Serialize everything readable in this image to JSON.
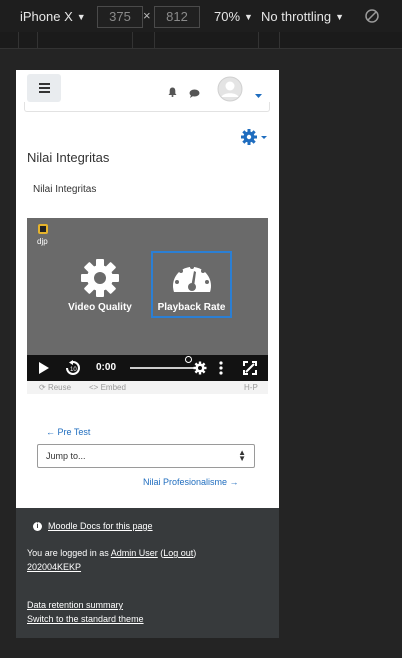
{
  "devtools": {
    "device": "iPhone X",
    "width": "375",
    "height": "812",
    "times": "×",
    "zoom": "70%",
    "throttling": "No throttling"
  },
  "page": {
    "title": "Nilai Integritas",
    "subtitle": "Nilai Integritas"
  },
  "player": {
    "logo_text": "djp",
    "video_quality": "Video Quality",
    "playback_rate": "Playback Rate",
    "time": "0:00",
    "reuse": "Reuse",
    "embed": "Embed",
    "h5p": "H-P"
  },
  "activity_nav": {
    "prev": "← Pre Test",
    "jump": "Jump to...",
    "next": "Nilai Profesionalisme →"
  },
  "footer": {
    "docs": "Moodle Docs for this page",
    "logged_prefix": "You are logged in as ",
    "user_name": "Admin User",
    "paren_open": " (",
    "logout": "Log out",
    "paren_close": ")",
    "user_id": "202004KEKP",
    "data_retention": "Data retention summary",
    "switch_theme": "Switch to the standard theme"
  },
  "colors": {
    "accent": "#1f6dbf",
    "footer_bg": "#373a3c",
    "player_bg": "#6a6a6a"
  }
}
